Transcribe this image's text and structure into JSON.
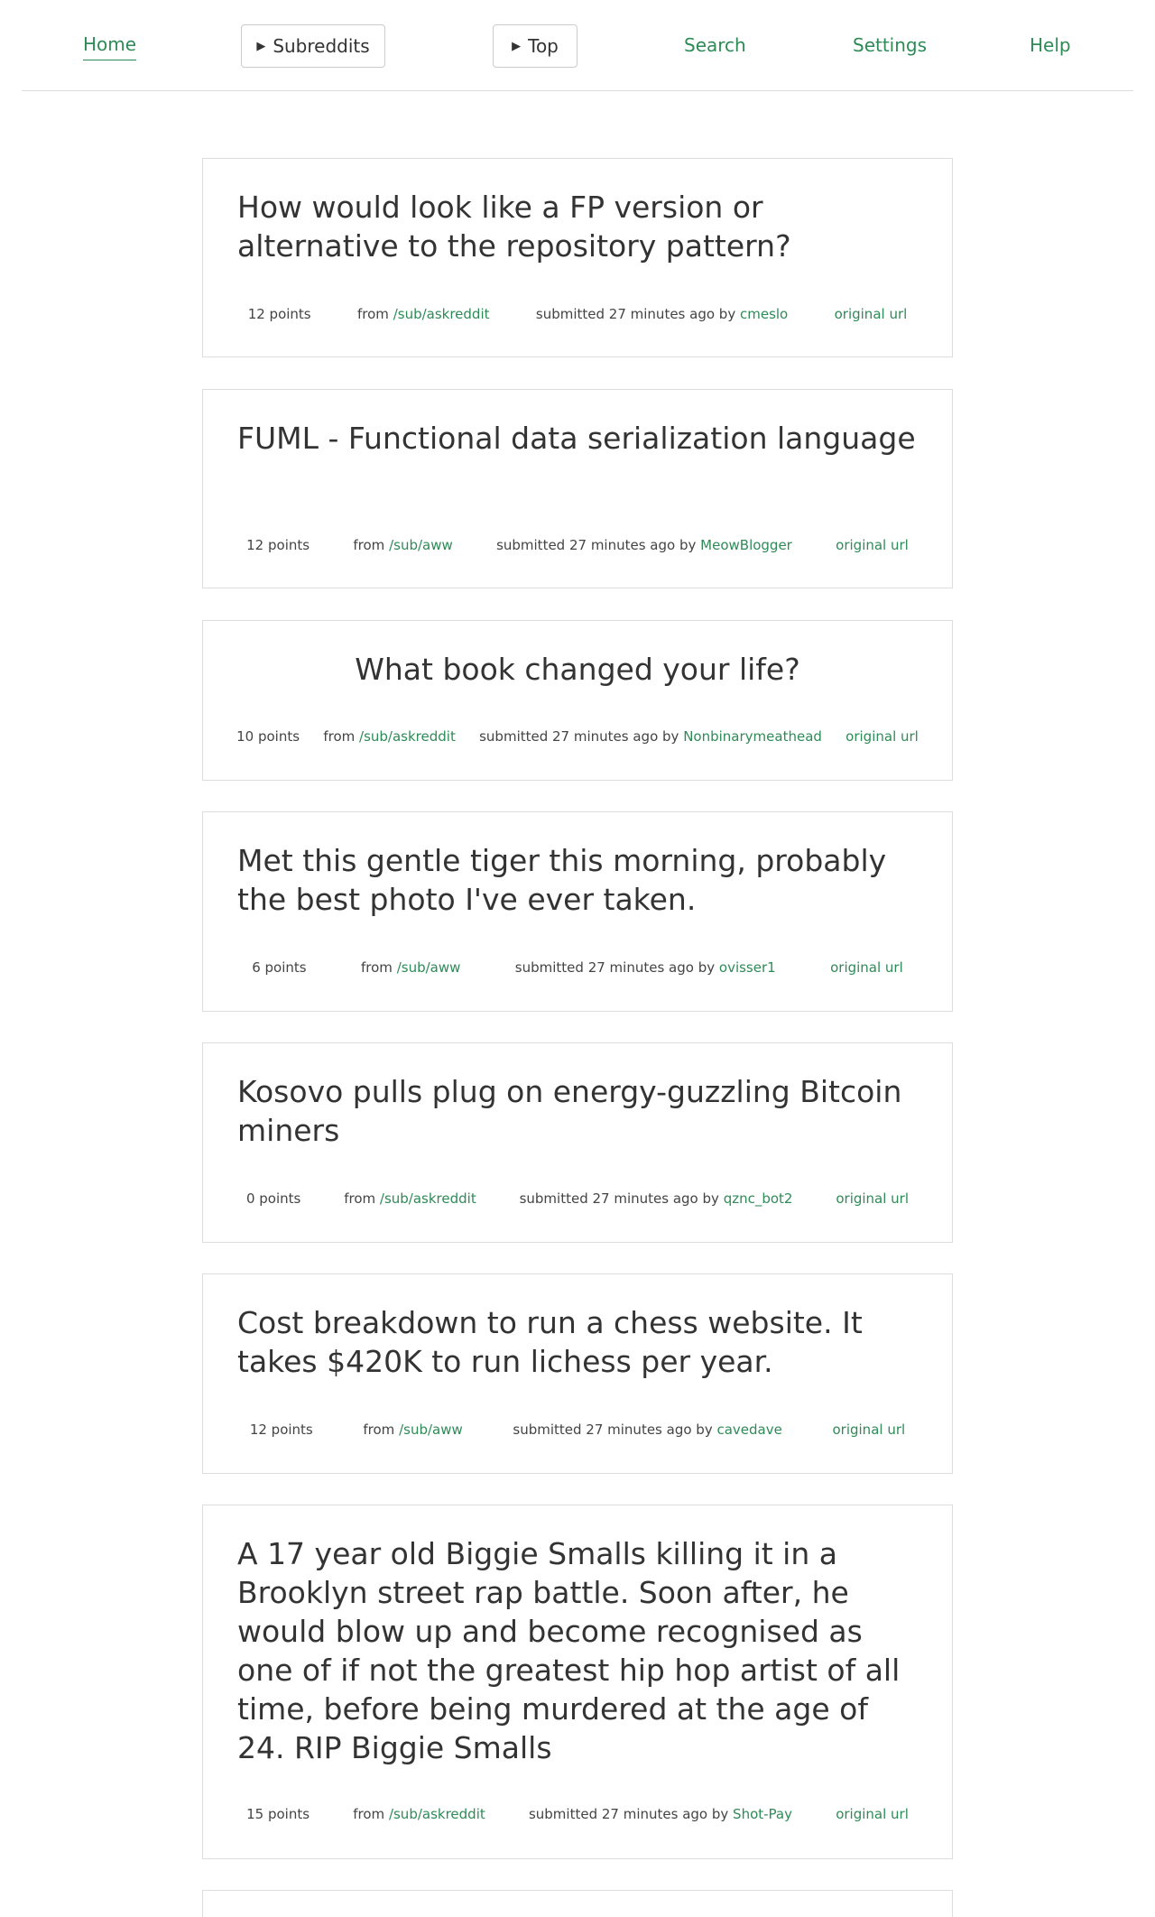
{
  "nav": {
    "home": "Home",
    "subreddits": "Subreddits",
    "top": "Top",
    "search": "Search",
    "settings": "Settings",
    "help": "Help"
  },
  "colors": {
    "accent": "#2e8b57",
    "text": "#333333",
    "border": "#dddddd"
  },
  "icons": {
    "dropdown": "triangle-right-icon"
  },
  "posts": [
    {
      "title": "How would look like a FP version or alternative to the repository pattern?",
      "points": "12 points",
      "from_label": "from",
      "subreddit": "/sub/askreddit",
      "submitted_label": "submitted 27 minutes ago by",
      "author": "cmeslo",
      "link": "original url"
    },
    {
      "title": "FUML - Functional data serialization language",
      "points": "12 points",
      "from_label": "from",
      "subreddit": "/sub/aww",
      "submitted_label": "submitted 27 minutes ago by",
      "author": "MeowBlogger",
      "link": "original url"
    },
    {
      "title": "What book changed your life?",
      "points": "10 points",
      "from_label": "from",
      "subreddit": "/sub/askreddit",
      "submitted_label": "submitted 27 minutes ago by",
      "author": "Nonbinarymeathead",
      "link": "original url"
    },
    {
      "title": "Met this gentle tiger this morning, probably the best photo I've ever taken.",
      "points": "6 points",
      "from_label": "from",
      "subreddit": "/sub/aww",
      "submitted_label": "submitted 27 minutes ago by",
      "author": "ovisser1",
      "link": "original url"
    },
    {
      "title": "Kosovo pulls plug on energy-guzzling Bitcoin miners",
      "points": "0 points",
      "from_label": "from",
      "subreddit": "/sub/askreddit",
      "submitted_label": "submitted 27 minutes ago by",
      "author": "qznc_bot2",
      "link": "original url"
    },
    {
      "title": "Cost breakdown to run a chess website. It takes $420K to run lichess per year.",
      "points": "12 points",
      "from_label": "from",
      "subreddit": "/sub/aww",
      "submitted_label": "submitted 27 minutes ago by",
      "author": "cavedave",
      "link": "original url"
    },
    {
      "title": "A 17 year old Biggie Smalls killing it in a Brooklyn street rap battle. Soon after, he would blow up and become recognised as one of if not the greatest hip hop artist of all time, before being murdered at the age of 24. RIP Biggie Smalls",
      "points": "15 points",
      "from_label": "from",
      "subreddit": "/sub/askreddit",
      "submitted_label": "submitted 27 minutes ago by",
      "author": "Shot-Pay",
      "link": "original url"
    }
  ]
}
